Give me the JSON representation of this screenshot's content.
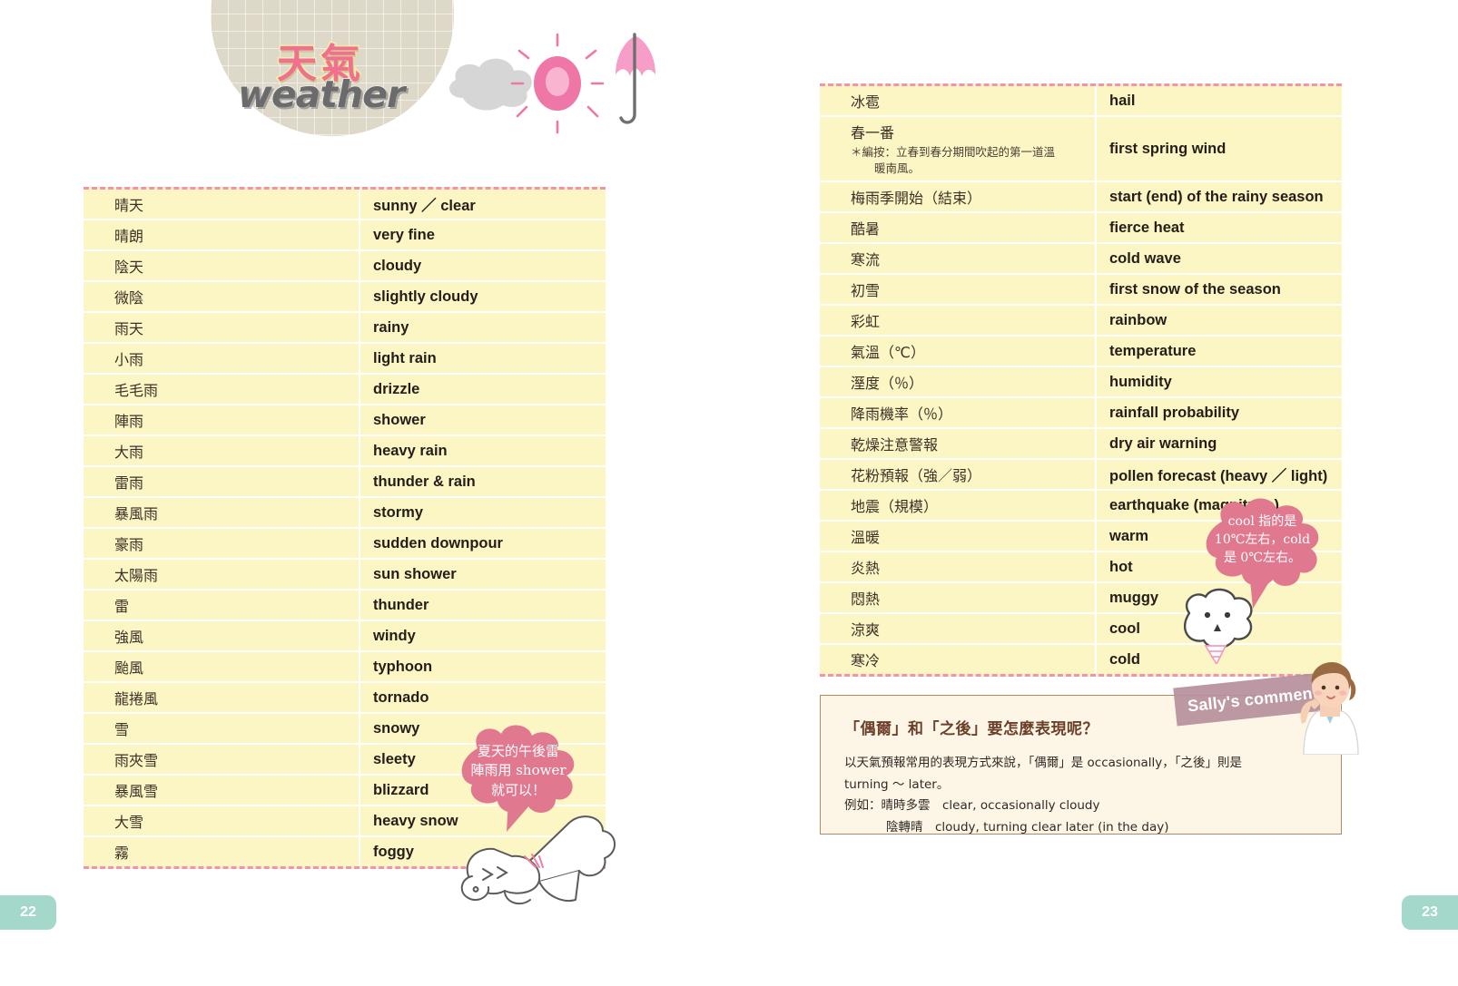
{
  "header": {
    "title_zh": "天氣",
    "title_en": "weather",
    "icons": [
      "cloud-icon",
      "sun-icon",
      "umbrella-icon"
    ]
  },
  "left_table": {
    "rows": [
      {
        "zh": "晴天",
        "en": "sunny ／ clear"
      },
      {
        "zh": "晴朗",
        "en": "very fine"
      },
      {
        "zh": "陰天",
        "en": "cloudy"
      },
      {
        "zh": "微陰",
        "en": "slightly cloudy"
      },
      {
        "zh": "雨天",
        "en": "rainy"
      },
      {
        "zh": "小雨",
        "en": "light rain"
      },
      {
        "zh": "毛毛雨",
        "en": "drizzle"
      },
      {
        "zh": "陣雨",
        "en": "shower"
      },
      {
        "zh": "大雨",
        "en": "heavy rain"
      },
      {
        "zh": "雷雨",
        "en": "thunder & rain"
      },
      {
        "zh": "暴風雨",
        "en": "stormy"
      },
      {
        "zh": "豪雨",
        "en": "sudden downpour"
      },
      {
        "zh": "太陽雨",
        "en": "sun shower"
      },
      {
        "zh": "雷",
        "en": "thunder"
      },
      {
        "zh": "強風",
        "en": "windy"
      },
      {
        "zh": "颱風",
        "en": "typhoon"
      },
      {
        "zh": "龍捲風",
        "en": "tornado"
      },
      {
        "zh": "雪",
        "en": "snowy"
      },
      {
        "zh": "雨夾雪",
        "en": "sleety"
      },
      {
        "zh": "暴風雪",
        "en": "blizzard"
      },
      {
        "zh": "大雪",
        "en": "heavy snow"
      },
      {
        "zh": "霧",
        "en": "foggy"
      }
    ]
  },
  "right_table": {
    "rows": [
      {
        "zh": "冰雹",
        "en": "hail"
      },
      {
        "zh": "春一番",
        "note": "＊編按：立春到春分期間吹起的第一道溫",
        "note2": "暖南風。",
        "en": "first spring wind"
      },
      {
        "zh": "梅雨季開始（結束）",
        "en": "start (end) of the rainy season"
      },
      {
        "zh": "酷暑",
        "en": "fierce heat"
      },
      {
        "zh": "寒流",
        "en": "cold wave"
      },
      {
        "zh": "初雪",
        "en": "first snow of the season"
      },
      {
        "zh": "彩虹",
        "en": "rainbow"
      },
      {
        "zh": "氣溫（℃）",
        "en": "temperature"
      },
      {
        "zh": "溼度（％）",
        "en": "humidity"
      },
      {
        "zh": "降雨機率（％）",
        "en": "rainfall probability"
      },
      {
        "zh": "乾燥注意警報",
        "en": "dry air warning"
      },
      {
        "zh": "花粉預報（強／弱）",
        "en": "pollen forecast (heavy ／ light)"
      },
      {
        "zh": "地震（規模）",
        "en": "earthquake (magnitude)"
      },
      {
        "zh": "溫暖",
        "en": "warm"
      },
      {
        "zh": "炎熱",
        "en": "hot"
      },
      {
        "zh": "悶熱",
        "en": "muggy"
      },
      {
        "zh": "涼爽",
        "en": "cool"
      },
      {
        "zh": "寒冷",
        "en": "cold"
      }
    ]
  },
  "bubble_left": {
    "line1": "夏天的午後雷",
    "line2": "陣雨用 shower",
    "line3": "就可以！"
  },
  "bubble_right": {
    "line1": "cool 指的是",
    "line2": "10℃左右，cold",
    "line3": "是 0℃左右。"
  },
  "sally": {
    "tape_label": "Sally's comment",
    "title": "「偶爾」和「之後」要怎麼表現呢？",
    "para1": "以天氣預報常用的表現方式來說，「偶爾」是 occasionally，「之後」則是",
    "para2": "turning ～ later。",
    "para3": "例如：晴時多雲　clear, occasionally cloudy",
    "para4": "陰轉晴　cloudy, turning clear later (in the day)"
  },
  "pages": {
    "left": "22",
    "right": "23"
  },
  "colors": {
    "table_bg": "#fcf6c5",
    "dashed_border": "#ef93b0",
    "bubble_pink": "#e0798f",
    "page_tab": "#a3d8cb",
    "title_zh": "#f07090",
    "comment_border": "#b08a63",
    "comment_bg": "#fdf6e6",
    "tape": "#b58f9c"
  }
}
